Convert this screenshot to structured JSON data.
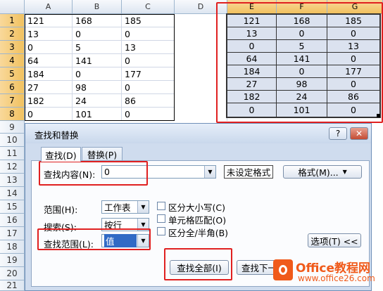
{
  "sheet": {
    "columns": [
      "A",
      "B",
      "C",
      "D",
      "E",
      "F",
      "G"
    ],
    "rows": [
      "1",
      "2",
      "3",
      "4",
      "5",
      "6",
      "7",
      "8",
      "9",
      "10",
      "11",
      "12",
      "13",
      "14",
      "15",
      "16",
      "17",
      "18",
      "19",
      "20",
      "21"
    ],
    "left_table": [
      [
        "121",
        "168",
        "185"
      ],
      [
        "13",
        "0",
        "0"
      ],
      [
        "0",
        "5",
        "13"
      ],
      [
        "64",
        "141",
        "0"
      ],
      [
        "184",
        "0",
        "177"
      ],
      [
        "27",
        "98",
        "0"
      ],
      [
        "182",
        "24",
        "86"
      ],
      [
        "0",
        "101",
        "0"
      ]
    ],
    "right_table": [
      [
        "121",
        "168",
        "185"
      ],
      [
        "13",
        "0",
        "0"
      ],
      [
        "0",
        "5",
        "13"
      ],
      [
        "64",
        "141",
        "0"
      ],
      [
        "184",
        "0",
        "177"
      ],
      [
        "27",
        "98",
        "0"
      ],
      [
        "182",
        "24",
        "86"
      ],
      [
        "0",
        "101",
        "0"
      ]
    ]
  },
  "dialog": {
    "title": "查找和替换",
    "help": "?",
    "close": "✕",
    "tabs": [
      "查找(D)",
      "替换(P)"
    ],
    "find_label": "查找内容(N):",
    "find_value": "0",
    "format_status": "未设定格式",
    "format_button": "格式(M)...",
    "within_label": "范围(H):",
    "within_value": "工作表",
    "search_label": "搜索(S):",
    "search_value": "按行",
    "lookin_label": "查找范围(L):",
    "lookin_value": "值",
    "match_case": "区分大小写(C)",
    "match_cell": "单元格匹配(O)",
    "match_width": "区分全/半角(B)",
    "options_button": "选项(T) <<",
    "find_all_button": "查找全部(I)",
    "find_next_button": "查找下一"
  },
  "watermark": {
    "brand": "Office教程网",
    "url": "www.office26.com"
  },
  "colors": {
    "annotation_red": "#e02020",
    "selection_fill": "#dbe2ef",
    "header_selected": "#f1c15f",
    "dialog_bg": "#cfdcee",
    "watermark_orange": "#f05a1a"
  }
}
